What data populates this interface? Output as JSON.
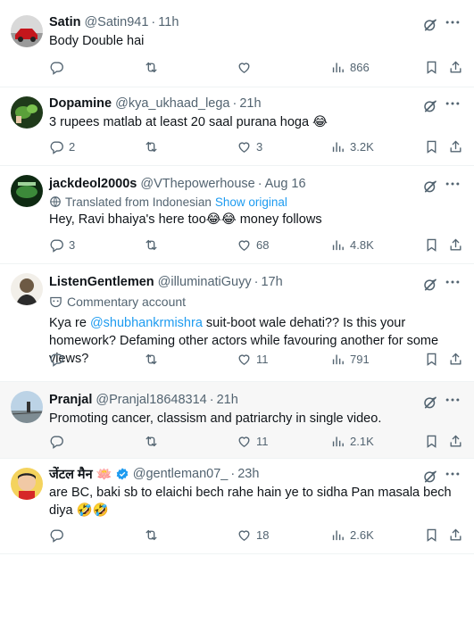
{
  "replies": [
    {
      "name": "Satin",
      "handle": "@Satin941",
      "time": "11h",
      "text": "Body Double hai",
      "stats": {
        "replies": "",
        "reposts": "",
        "likes": "",
        "views": "866"
      }
    },
    {
      "name": "Dopamine",
      "handle": "@kya_ukhaad_lega",
      "time": "21h",
      "text": "3 rupees matlab at least 20 saal purana hoga 😂",
      "stats": {
        "replies": "2",
        "reposts": "",
        "likes": "3",
        "views": "3.2K"
      }
    },
    {
      "name": "jackdeol2000s",
      "handle": "@VThepowerhouse",
      "time": "Aug 16",
      "translated_label": "Translated from Indonesian",
      "show_original": "Show original",
      "text": "Hey, Ravi bhaiya's here too😂😂 money follows",
      "stats": {
        "replies": "3",
        "reposts": "",
        "likes": "68",
        "views": "4.8K"
      }
    },
    {
      "name": "ListenGentlemen",
      "handle": "@illuminatiGuyy",
      "time": "17h",
      "commentary_label": "Commentary account",
      "text_before": "Kya re ",
      "mention": "@shubhankrmishra",
      "text_after": " suit-boot wale dehati?? Is this your homework? Defaming other actors while favouring another for some views?",
      "stats": {
        "replies": "",
        "reposts": "",
        "likes": "11",
        "views": "791"
      }
    },
    {
      "name": "Pranjal",
      "handle": "@Pranjal18648314",
      "time": "21h",
      "text": "Promoting cancer, classism and patriarchy  in single video.",
      "stats": {
        "replies": "",
        "reposts": "",
        "likes": "11",
        "views": "2.1K"
      }
    },
    {
      "name": "जेंटल मैन 🪷",
      "handle": "@gentleman07_",
      "time": "23h",
      "text": "are BC, baki sb to elaichi bech rahe hain ye to sidha Pan masala bech diya 🤣🤣",
      "stats": {
        "replies": "",
        "reposts": "",
        "likes": "18",
        "views": "2.6K"
      }
    }
  ],
  "separator": "·",
  "colors": {
    "accent": "#1d9bf0",
    "muted": "#536471",
    "text": "#0f1419",
    "border": "#eff3f4",
    "shaded": "#f7f7f7"
  },
  "icons": [
    "grok-icon",
    "more-icon",
    "reply-icon",
    "repost-icon",
    "like-icon",
    "views-icon",
    "bookmark-icon",
    "share-icon",
    "verified-badge-icon",
    "commentary-mask-icon"
  ]
}
